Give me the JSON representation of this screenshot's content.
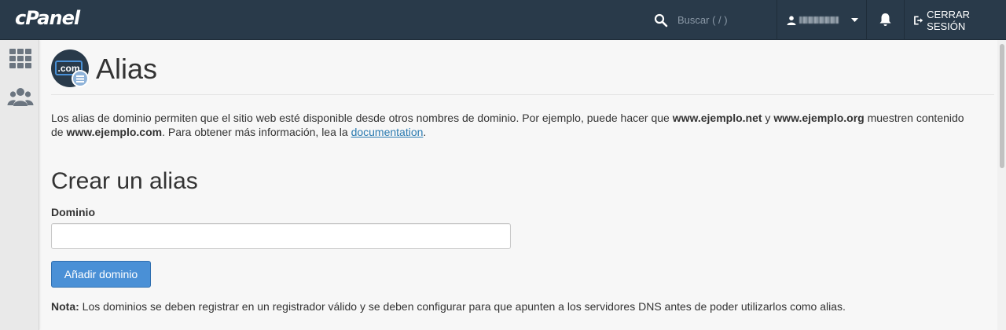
{
  "brand": {
    "logo_text": "cPanel"
  },
  "topbar": {
    "search_placeholder": "Buscar ( / )",
    "logout_label": "CERRAR SESIÓN"
  },
  "sidebar": {
    "items": [
      {
        "icon": "apps-grid-icon"
      },
      {
        "icon": "users-icon"
      }
    ]
  },
  "page": {
    "title": "Alias",
    "description": {
      "part1": "Los alias de dominio permiten que el sitio web esté disponible desde otros nombres de dominio. Por ejemplo, puede hacer que ",
      "example1": "www.ejemplo.net",
      "part2": " y ",
      "example2": "www.ejemplo.org",
      "part3": " muestren contenido de ",
      "example3": "www.ejemplo.com",
      "part4": ". Para obtener más información, lea la ",
      "link": "documentation",
      "part5": "."
    },
    "form": {
      "section_title": "Crear un alias",
      "domain_label": "Dominio",
      "domain_value": "",
      "submit_label": "Añadir dominio"
    },
    "note": {
      "label": "Nota:",
      "text": " Los dominios se deben registrar en un registrador válido y se deben configurar para que apunten a los servidores DNS antes de poder utilizarlos como alias."
    }
  },
  "colors": {
    "topbar": "#293a4a",
    "button": "#4a90d6",
    "link": "#2a7ab0",
    "background": "#f7f7f7"
  }
}
